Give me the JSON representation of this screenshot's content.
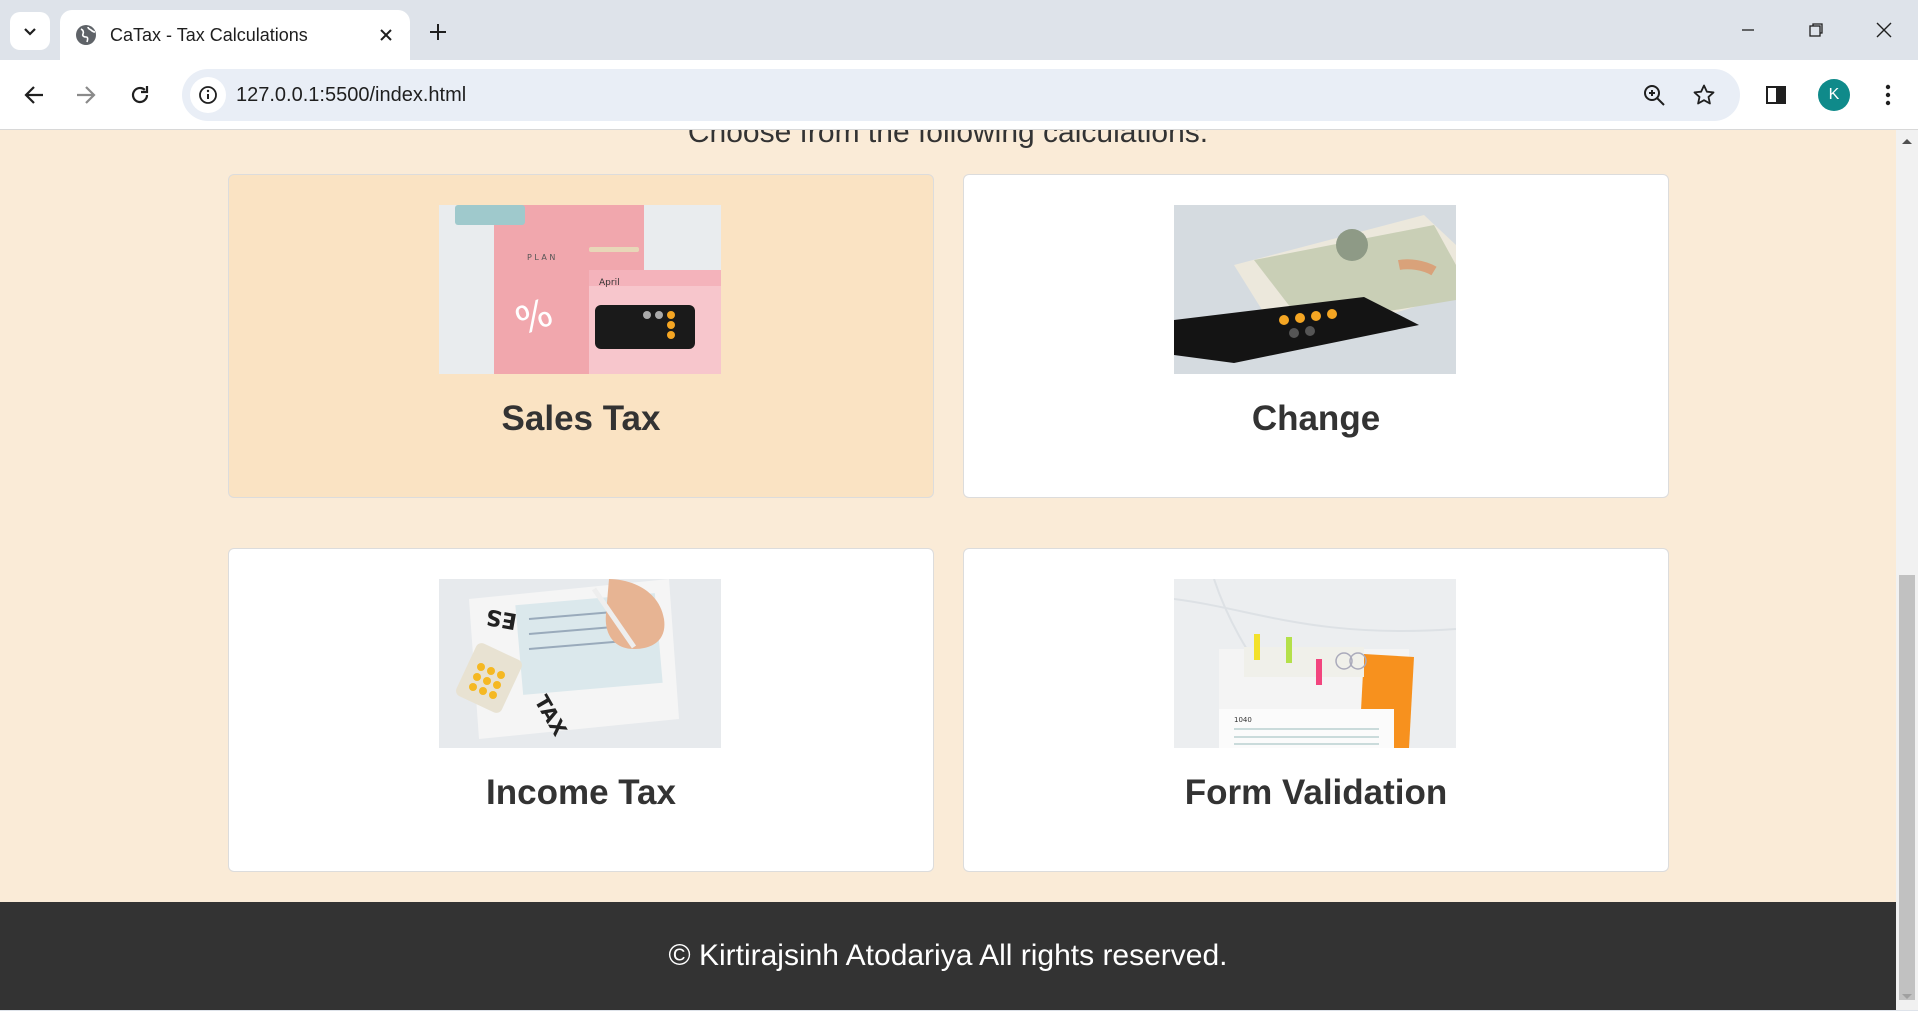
{
  "browser": {
    "tab_title": "CaTax - Tax Calculations",
    "url": "127.0.0.1:5500/index.html",
    "profile_initial": "K"
  },
  "page": {
    "subtitle": "Choose from the following calculations.",
    "cards": [
      {
        "label": "Sales Tax",
        "image": "calendar-calculator-photo"
      },
      {
        "label": "Change",
        "image": "cash-phone-photo"
      },
      {
        "label": "Income Tax",
        "image": "tax-form-writing-photo"
      },
      {
        "label": "Form Validation",
        "image": "form-1040-clips-photo"
      }
    ],
    "footer": "© Kirtirajsinh Atodariya All rights reserved."
  },
  "colors": {
    "page_bg": "#faebd7",
    "card_hover": "#fae3c3",
    "footer_bg": "#333333",
    "avatar": "#0f8a8a"
  }
}
